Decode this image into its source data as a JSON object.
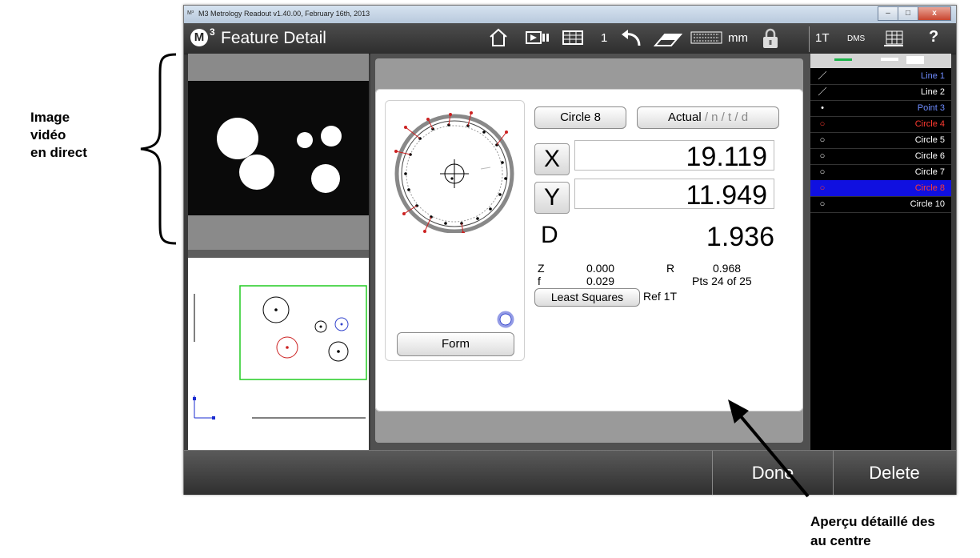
{
  "window": {
    "title": "M3 Metrology Readout  v1.40.00, February 16th, 2013",
    "controls": {
      "minimize": "–",
      "maximize": "□",
      "close": "x"
    }
  },
  "toolbar": {
    "logo": "M",
    "logo_sup": "3",
    "page_title": "Feature Detail",
    "count": "1",
    "units": "mm",
    "ref": "1T",
    "angle_format": "DMS",
    "help": "?"
  },
  "annotations": {
    "left": [
      "Image",
      "vidéo",
      "en direct"
    ],
    "bottom": [
      "Aperçu détaillé des",
      "au centre"
    ]
  },
  "detail": {
    "feature_button": "Circle 8",
    "mode_button_main": "Actual",
    "mode_button_rest": " / n / t / d",
    "x_label": "X",
    "x_value": "19.119",
    "y_label": "Y",
    "y_value": "11.949",
    "d_label": "D",
    "d_value": "1.936",
    "z_label": "Z",
    "z_value": "0.000",
    "r_label": "R",
    "r_value": "0.968",
    "f_label": "f",
    "f_value": "0.029",
    "pts": "Pts 24 of 25",
    "fit_button": "Least Squares",
    "ref_text": "Ref 1T",
    "form_button": "Form"
  },
  "features": [
    {
      "icon": "line-icon",
      "glyph": "／",
      "label": "Line 1",
      "color": "#6f8cff",
      "selected": false
    },
    {
      "icon": "line-icon",
      "glyph": "／",
      "label": "Line 2",
      "color": "#ffffff",
      "selected": false
    },
    {
      "icon": "point-icon",
      "glyph": "•",
      "label": "Point 3",
      "color": "#6f8cff",
      "selected": false
    },
    {
      "icon": "circle-icon",
      "glyph": "○",
      "label": "Circle 4",
      "color": "#ff3b30",
      "selected": false
    },
    {
      "icon": "circle-icon",
      "glyph": "○",
      "label": "Circle 5",
      "color": "#ffffff",
      "selected": false
    },
    {
      "icon": "circle-icon",
      "glyph": "○",
      "label": "Circle 6",
      "color": "#ffffff",
      "selected": false
    },
    {
      "icon": "circle-icon",
      "glyph": "○",
      "label": "Circle 7",
      "color": "#ffffff",
      "selected": false
    },
    {
      "icon": "circle-icon",
      "glyph": "○",
      "label": "Circle 8",
      "color": "#ff3b30",
      "selected": true
    },
    {
      "icon": "circle-icon",
      "glyph": "○",
      "label": "Circle 10",
      "color": "#ffffff",
      "selected": false
    }
  ],
  "bottom": {
    "done": "Done",
    "delete": "Delete"
  },
  "colors": {
    "selected_row": "#1010e0",
    "overview_frame": "#22cc22",
    "accent_red": "#ff3b30",
    "accent_blue": "#6f8cff"
  }
}
